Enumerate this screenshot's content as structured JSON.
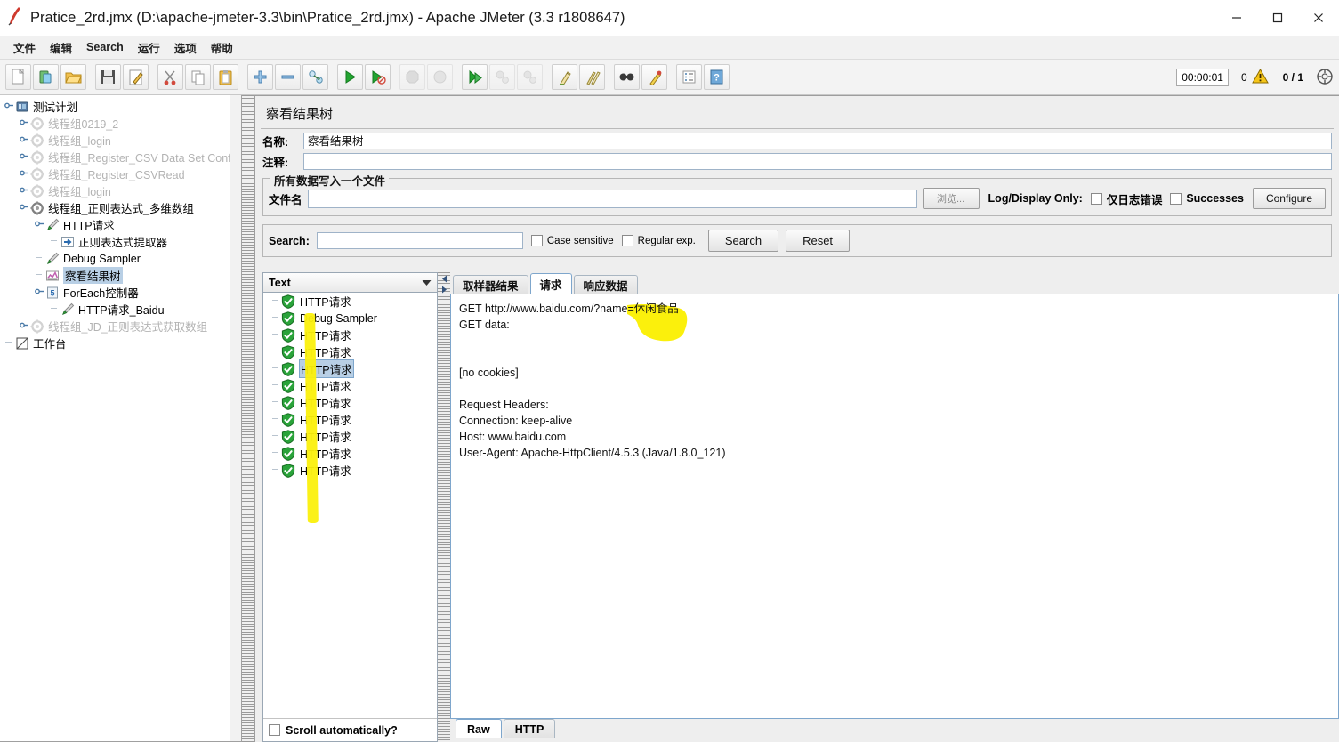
{
  "window": {
    "title": "Pratice_2rd.jmx (D:\\apache-jmeter-3.3\\bin\\Pratice_2rd.jmx) - Apache JMeter (3.3 r1808647)",
    "app_icon": "jmeter-feather-icon",
    "controls": {
      "minimize": "minimize-icon",
      "maximize": "maximize-icon",
      "close": "close-icon"
    }
  },
  "menubar": {
    "items": [
      {
        "label": "文件"
      },
      {
        "label": "编辑"
      },
      {
        "label": "Search"
      },
      {
        "label": "运行"
      },
      {
        "label": "选项"
      },
      {
        "label": "帮助"
      }
    ]
  },
  "toolbar": {
    "buttons": [
      {
        "name": "new-icon"
      },
      {
        "name": "templates-icon"
      },
      {
        "name": "open-icon"
      },
      {
        "name": "save-icon"
      },
      {
        "name": "save-as-icon"
      },
      {
        "name": "cut-icon"
      },
      {
        "name": "copy-icon"
      },
      {
        "name": "paste-icon"
      },
      {
        "name": "expand-all-icon"
      },
      {
        "name": "collapse-all-icon"
      },
      {
        "name": "toggle-icon"
      },
      {
        "name": "start-icon"
      },
      {
        "name": "start-no-timers-icon"
      },
      {
        "name": "stop-icon"
      },
      {
        "name": "shutdown-icon"
      },
      {
        "name": "remote-start-all-icon"
      },
      {
        "name": "remote-stop-all-icon"
      },
      {
        "name": "remote-shutdown-all-icon"
      },
      {
        "name": "clear-icon"
      },
      {
        "name": "clear-all-icon"
      },
      {
        "name": "search-icon"
      },
      {
        "name": "search-reset-icon"
      },
      {
        "name": "function-helper-icon"
      },
      {
        "name": "help-icon"
      }
    ],
    "timer": "00:00:01",
    "warning_count": "0",
    "warning_icon": "warning-triangle-icon",
    "thread_count": "0 / 1",
    "status_icon": "gear-status-icon"
  },
  "tree": {
    "nodes": [
      {
        "label": "测试计划",
        "icon": "test-plan-icon",
        "depth": 0,
        "disabled": false,
        "selected": false,
        "expander": "expanded"
      },
      {
        "label": "线程组0219_2",
        "icon": "thread-group-icon",
        "depth": 1,
        "disabled": true,
        "selected": false,
        "expander": "collapsed"
      },
      {
        "label": "线程组_login",
        "icon": "thread-group-icon",
        "depth": 1,
        "disabled": true,
        "selected": false,
        "expander": "collapsed"
      },
      {
        "label": "线程组_Register_CSV Data Set Config",
        "icon": "thread-group-icon",
        "depth": 1,
        "disabled": true,
        "selected": false,
        "expander": "collapsed"
      },
      {
        "label": "线程组_Register_CSVRead",
        "icon": "thread-group-icon",
        "depth": 1,
        "disabled": true,
        "selected": false,
        "expander": "collapsed"
      },
      {
        "label": "线程组_login",
        "icon": "thread-group-icon",
        "depth": 1,
        "disabled": true,
        "selected": false,
        "expander": "collapsed"
      },
      {
        "label": "线程组_正则表达式_多维数组",
        "icon": "thread-group-icon",
        "depth": 1,
        "disabled": false,
        "selected": false,
        "expander": "expanded"
      },
      {
        "label": "HTTP请求",
        "icon": "http-sampler-icon",
        "depth": 2,
        "disabled": false,
        "selected": false,
        "expander": "expanded"
      },
      {
        "label": "正则表达式提取器",
        "icon": "regex-extractor-icon",
        "depth": 3,
        "disabled": false,
        "selected": false,
        "expander": "none"
      },
      {
        "label": "Debug Sampler",
        "icon": "http-sampler-icon",
        "depth": 2,
        "disabled": false,
        "selected": false,
        "expander": "none"
      },
      {
        "label": "察看结果树",
        "icon": "view-results-tree-icon",
        "depth": 2,
        "disabled": false,
        "selected": true,
        "expander": "none"
      },
      {
        "label": "ForEach控制器",
        "icon": "foreach-controller-icon",
        "depth": 2,
        "disabled": false,
        "selected": false,
        "expander": "expanded"
      },
      {
        "label": "HTTP请求_Baidu",
        "icon": "http-sampler-icon",
        "depth": 3,
        "disabled": false,
        "selected": false,
        "expander": "none"
      },
      {
        "label": "线程组_JD_正则表达式获取数组",
        "icon": "thread-group-icon",
        "depth": 1,
        "disabled": true,
        "selected": false,
        "expander": "collapsed"
      },
      {
        "label": "工作台",
        "icon": "workbench-icon",
        "depth": 0,
        "disabled": false,
        "selected": false,
        "expander": "none"
      }
    ]
  },
  "panel": {
    "title": "察看结果树",
    "name_label": "名称:",
    "name_value": "察看结果树",
    "comment_label": "注释:",
    "comment_value": "",
    "file_group_title": "所有数据写入一个文件",
    "filename_label": "文件名",
    "filename_value": "",
    "browse_button": "浏览...",
    "log_display_label": "Log/Display Only:",
    "errors_only_label": "仅日志错误",
    "errors_only_checked": false,
    "successes_label": "Successes",
    "successes_checked": false,
    "configure_button": "Configure"
  },
  "search": {
    "label": "Search:",
    "value": "",
    "case_sensitive_label": "Case sensitive",
    "case_sensitive_checked": false,
    "regular_exp_label": "Regular exp.",
    "regular_exp_checked": false,
    "search_button": "Search",
    "reset_button": "Reset"
  },
  "results": {
    "render_selector": "Text",
    "items": [
      {
        "label": "HTTP请求",
        "status": "success",
        "selected": false
      },
      {
        "label": "Debug Sampler",
        "status": "success",
        "selected": false
      },
      {
        "label": "HTTP请求",
        "status": "success",
        "selected": false
      },
      {
        "label": "HTTP请求",
        "status": "success",
        "selected": false
      },
      {
        "label": "HTTP请求",
        "status": "success",
        "selected": true
      },
      {
        "label": "HTTP请求",
        "status": "success",
        "selected": false
      },
      {
        "label": "HTTP请求",
        "status": "success",
        "selected": false
      },
      {
        "label": "HTTP请求",
        "status": "success",
        "selected": false
      },
      {
        "label": "HTTP请求",
        "status": "success",
        "selected": false
      },
      {
        "label": "HTTP请求",
        "status": "success",
        "selected": false
      },
      {
        "label": "HTTP请求",
        "status": "success",
        "selected": false
      }
    ],
    "scroll_auto_label": "Scroll automatically?",
    "scroll_auto_checked": false,
    "tabs": [
      {
        "label": "取样器结果",
        "active": false
      },
      {
        "label": "请求",
        "active": true
      },
      {
        "label": "响应数据",
        "active": false
      }
    ],
    "bottom_tabs": [
      {
        "label": "Raw",
        "active": true
      },
      {
        "label": "HTTP",
        "active": false
      }
    ],
    "request_line_prefix": "GET http://www.baidu.com/?name=",
    "request_line_highlight": "休闲食品",
    "request_body": "\nGET data:\n\n\n[no cookies]\n\nRequest Headers:\nConnection: keep-alive\nHost: www.baidu.com\nUser-Agent: Apache-HttpClient/4.5.3 (Java/1.8.0_121)"
  },
  "annotations": {
    "highlighter_color": "#fbf00c",
    "strokes": [
      "vertical-stripe-over-results-list",
      "blob-over-request-query-value"
    ]
  }
}
